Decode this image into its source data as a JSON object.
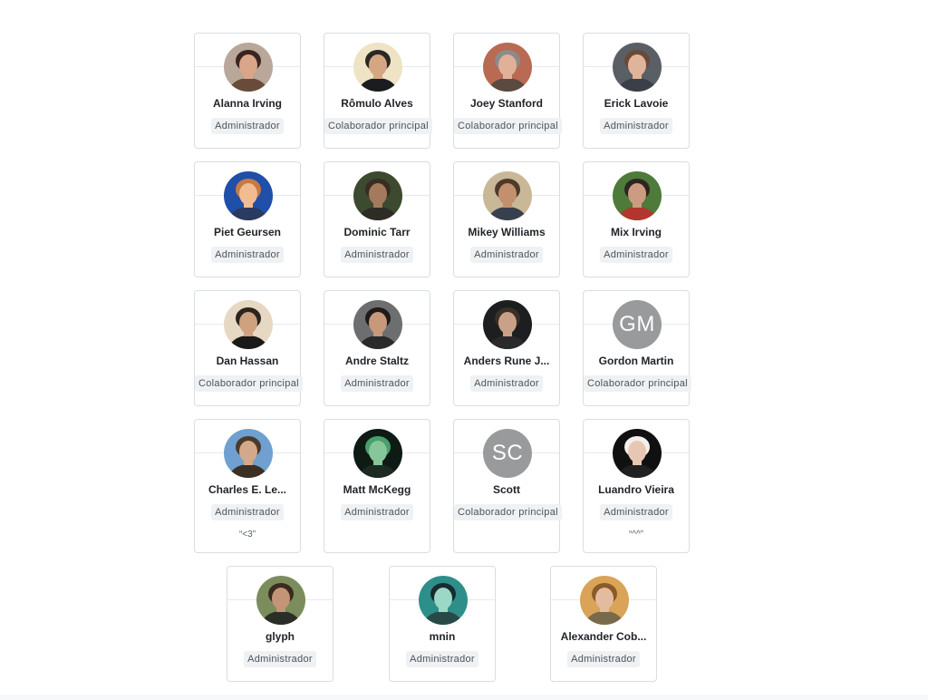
{
  "members": [
    {
      "name": "Alanna Irving",
      "role": "Administrador",
      "avatar": "photo",
      "colors": [
        "#b9a79a",
        "#3a2520",
        "#d9a68a",
        "#6a4a3a"
      ]
    },
    {
      "name": "Rômulo Alves",
      "role": "Colaborador principal",
      "avatar": "photo",
      "colors": [
        "#efe3c5",
        "#2a2826",
        "#d4a782",
        "#1b1c20"
      ]
    },
    {
      "name": "Joey Stanford",
      "role": "Colaborador principal",
      "avatar": "photo",
      "colors": [
        "#b96a52",
        "#8b8b8b",
        "#e0b098",
        "#5a4a40"
      ]
    },
    {
      "name": "Erick Lavoie",
      "role": "Administrador",
      "avatar": "photo",
      "colors": [
        "#5a5f65",
        "#6a4a35",
        "#e0b49a",
        "#3b3f48"
      ]
    },
    {
      "name": "Piet Geursen",
      "role": "Administrador",
      "avatar": "photo",
      "colors": [
        "#1f4fa8",
        "#c77a45",
        "#f0bc90",
        "#2b3a60"
      ]
    },
    {
      "name": "Dominic Tarr",
      "role": "Administrador",
      "avatar": "photo",
      "colors": [
        "#3c4a2f",
        "#3a2c22",
        "#a37b5c",
        "#2e2c26"
      ]
    },
    {
      "name": "Mikey Williams",
      "role": "Administrador",
      "avatar": "photo",
      "colors": [
        "#c9b898",
        "#4d3a2b",
        "#c2906e",
        "#37404c"
      ]
    },
    {
      "name": "Mix Irving",
      "role": "Administrador",
      "avatar": "photo",
      "colors": [
        "#4e7a3a",
        "#2d2620",
        "#cc9c82",
        "#b2362e"
      ]
    },
    {
      "name": "Dan Hassan",
      "role": "Colaborador principal",
      "avatar": "photo",
      "colors": [
        "#e6d8c2",
        "#2c241e",
        "#ceA27e",
        "#1a1a1a"
      ]
    },
    {
      "name": "Andre Staltz",
      "role": "Administrador",
      "avatar": "photo",
      "colors": [
        "#6d6e70",
        "#1e1a18",
        "#c8987a",
        "#2a2a2a"
      ]
    },
    {
      "name": "Anders Rune J...",
      "role": "Administrador",
      "avatar": "photo",
      "colors": [
        "#1c1e20",
        "#3a3026",
        "#c9a088",
        "#2a2a2c"
      ]
    },
    {
      "name": "Gordon Martin",
      "role": "Colaborador principal",
      "avatar": "initials",
      "initials": "GM"
    },
    {
      "name": "Charles E. Le...",
      "role": "Administrador",
      "avatar": "photo",
      "note": "“<3”",
      "colors": [
        "#6fa0d0",
        "#4a3a2c",
        "#d3a98a",
        "#3a3024"
      ]
    },
    {
      "name": "Matt McKegg",
      "role": "Administrador",
      "avatar": "photo",
      "colors": [
        "#0e1a14",
        "#48a06a",
        "#86c69a",
        "#1c2a22"
      ]
    },
    {
      "name": "Scott",
      "role": "Colaborador principal",
      "avatar": "initials",
      "initials": "SC"
    },
    {
      "name": "Luandro Vieira",
      "role": "Administrador",
      "avatar": "photo",
      "note": "“^^”",
      "colors": [
        "#101010",
        "#f3f0ec",
        "#e7c6b4",
        "#202020"
      ]
    },
    {
      "name": "glyph",
      "role": "Administrador",
      "avatar": "photo",
      "colors": [
        "#7b8c5d",
        "#3b2a1f",
        "#c49477",
        "#2a2e26"
      ]
    },
    {
      "name": "mnin",
      "role": "Administrador",
      "avatar": "photo",
      "colors": [
        "#2e8f8a",
        "#1a2a2e",
        "#9cd8c6",
        "#284a46"
      ]
    },
    {
      "name": "Alexander Cob...",
      "role": "Administrador",
      "avatar": "photo",
      "colors": [
        "#d9a457",
        "#8a5a2a",
        "#e3bca0",
        "#7a6a4c"
      ]
    }
  ]
}
